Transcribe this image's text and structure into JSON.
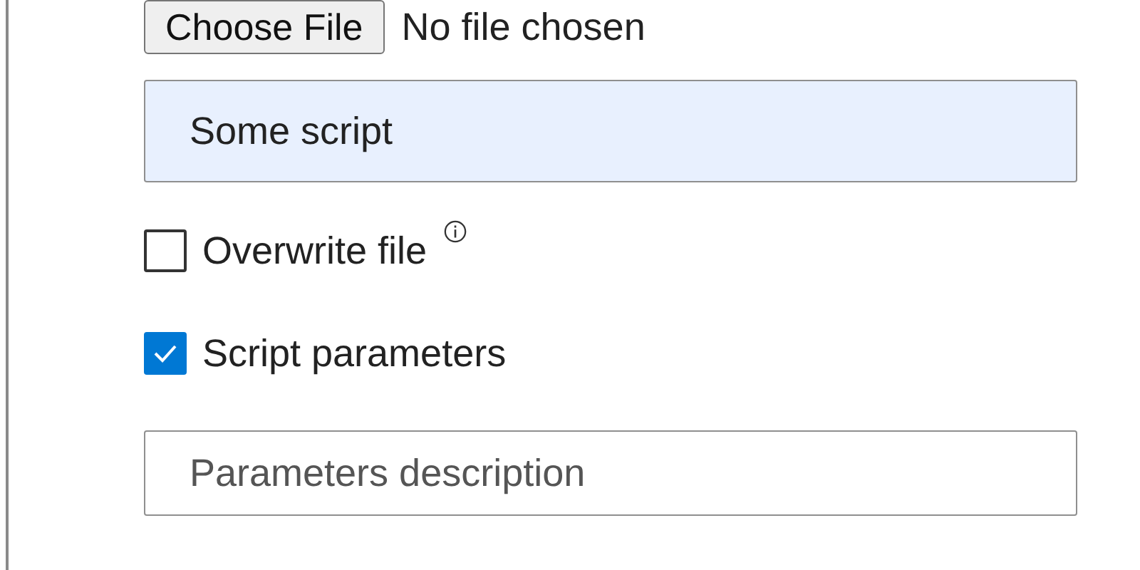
{
  "file_picker": {
    "button": "Choose File",
    "status": "No file chosen"
  },
  "name_field": {
    "value": "Some script"
  },
  "options": [
    {
      "label": "Overwrite file",
      "checked": false,
      "info": true
    },
    {
      "label": "Script parameters",
      "checked": true,
      "info": false
    }
  ],
  "description_field": {
    "placeholder": "Parameters description"
  }
}
